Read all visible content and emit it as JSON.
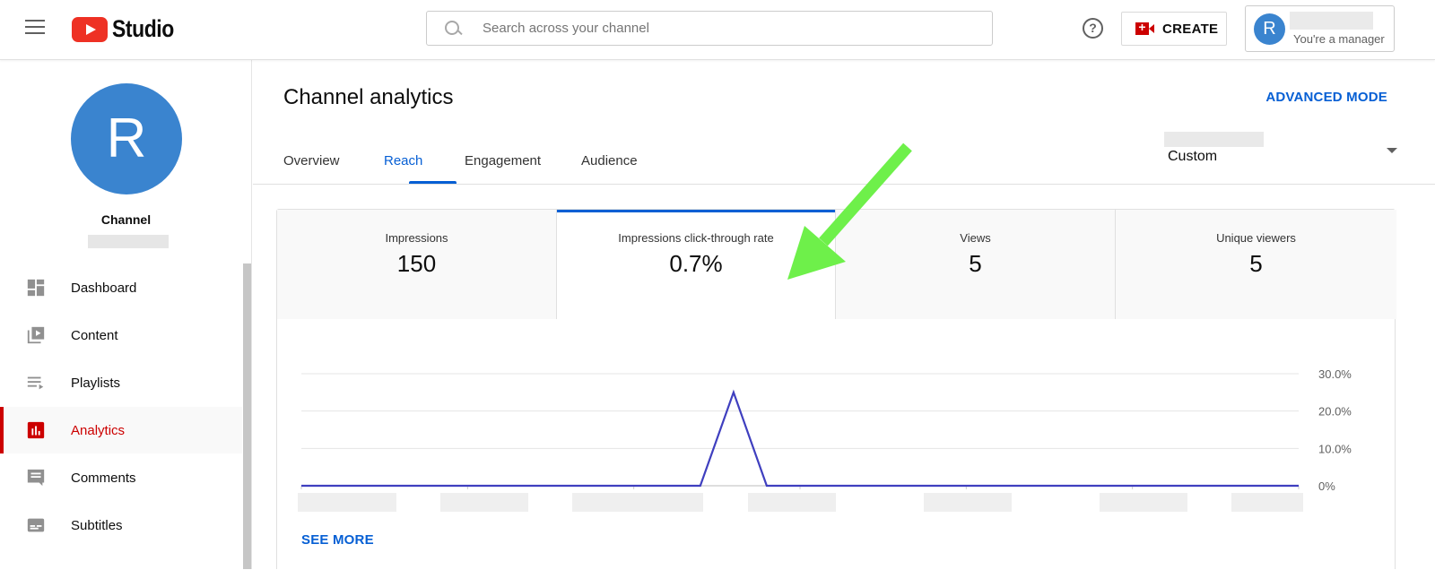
{
  "header": {
    "menu_icon": "hamburger-menu-icon",
    "logo_text": "Studio",
    "search_placeholder": "Search across your channel",
    "help_symbol": "?",
    "create_label": "CREATE",
    "account_initial": "R",
    "account_role": "You're a manager"
  },
  "sidebar": {
    "channel_initial": "R",
    "channel_label": "Channel",
    "items": [
      {
        "label": "Dashboard",
        "icon": "dashboard-icon"
      },
      {
        "label": "Content",
        "icon": "content-icon"
      },
      {
        "label": "Playlists",
        "icon": "playlists-icon"
      },
      {
        "label": "Analytics",
        "icon": "analytics-icon",
        "active": true
      },
      {
        "label": "Comments",
        "icon": "comments-icon"
      },
      {
        "label": "Subtitles",
        "icon": "subtitles-icon"
      }
    ]
  },
  "main": {
    "title": "Channel analytics",
    "advanced_mode": "ADVANCED MODE",
    "tabs": [
      {
        "label": "Overview"
      },
      {
        "label": "Reach",
        "active": true
      },
      {
        "label": "Engagement"
      },
      {
        "label": "Audience"
      }
    ],
    "date_range": "Custom",
    "metrics": [
      {
        "label": "Impressions",
        "value": "150"
      },
      {
        "label": "Impressions click-through rate",
        "value": "0.7%",
        "active": true
      },
      {
        "label": "Views",
        "value": "5"
      },
      {
        "label": "Unique viewers",
        "value": "5"
      }
    ],
    "see_more": "SEE MORE"
  },
  "colors": {
    "accent_blue": "#065fd4",
    "brand_red": "#cc0000",
    "line_color": "#3f3fbf",
    "annotation_green": "#6ef04a"
  },
  "chart_data": {
    "type": "line",
    "title": "Impressions click-through rate",
    "xlabel": "",
    "ylabel": "",
    "x_tick_labels_redacted": true,
    "y_ticks": [
      "0%",
      "10.0%",
      "20.0%",
      "30.0%"
    ],
    "ylim": [
      0,
      30
    ],
    "y_axis_side": "right",
    "grid": true,
    "series": [
      {
        "name": "Impressions click-through rate (%)",
        "values": [
          0,
          0,
          0,
          0,
          0,
          0,
          0,
          0,
          0,
          0,
          0,
          0,
          0,
          25,
          0,
          0,
          0,
          0,
          0,
          0,
          0,
          0,
          0,
          0,
          0,
          0,
          0,
          0,
          0,
          0,
          0
        ]
      }
    ]
  }
}
